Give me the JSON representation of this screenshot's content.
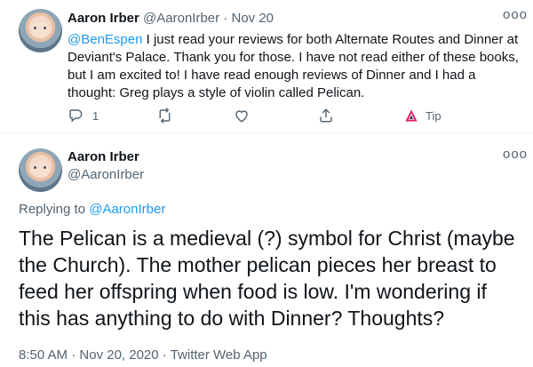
{
  "tweet_top": {
    "author_name": "Aaron Irber",
    "handle": "@AaronIrber",
    "separator": "·",
    "date": "Nov 20",
    "more_label": "ooo",
    "mention": "@BenEspen",
    "text": " I just read your reviews for both Alternate Routes and Dinner at Deviant's Palace. Thank you for those. I have not read either of these books, but I am excited to! I have read enough reviews of Dinner and I had a thought: Greg plays a style of violin called Pelican.",
    "reply_count": "1",
    "tip_label": "Tip",
    "icons": [
      "reply-icon",
      "retweet-icon",
      "like-icon",
      "share-icon",
      "tip-icon"
    ],
    "tip_color": "#e0245e"
  },
  "tweet_main": {
    "author_name": "Aaron Irber",
    "handle": "@AaronIrber",
    "more_label": "ooo",
    "replying_prefix": "Replying to ",
    "replying_handle": "@AaronIrber",
    "text": "The Pelican is a medieval (?) symbol for Christ (maybe the Church). The mother pelican pieces her breast to feed her offspring when food is low. I'm wondering if this has anything to do with Dinner? Thoughts?",
    "time": "8:50 AM",
    "date": "Nov 20, 2020",
    "source": "Twitter Web App",
    "separator": "·"
  },
  "colors": {
    "link": "#1d9bf0",
    "muted": "#536471",
    "text": "#0f1419"
  }
}
